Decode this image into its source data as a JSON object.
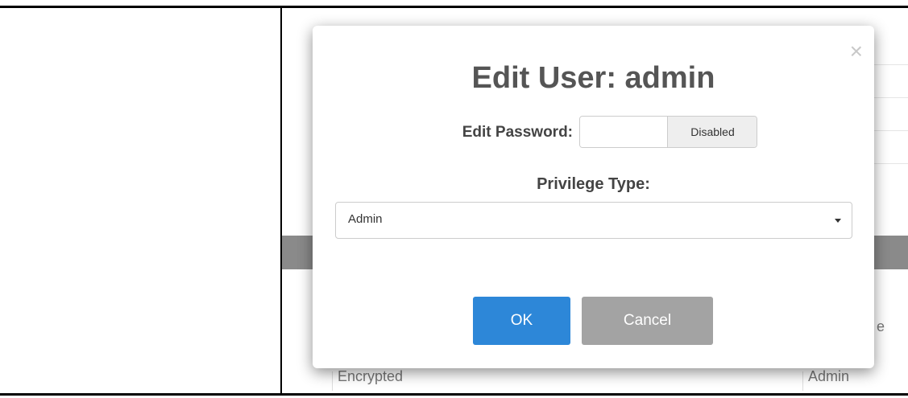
{
  "dialog": {
    "title": "Edit User: admin",
    "close_glyph": "×",
    "password_label": "Edit Password:",
    "password_value": "",
    "password_toggle_label": "Disabled",
    "privilege_label": "Privilege Type:",
    "privilege_selected": "Admin",
    "ok_label": "OK",
    "cancel_label": "Cancel"
  },
  "background_table": {
    "row_encryption": "Encrypted",
    "row_privilege": "Admin",
    "header_fragment_right": "e"
  },
  "colors": {
    "ok_button": "#2d87d8",
    "cancel_button": "#a3a3a3",
    "band": "#8a8a8a"
  }
}
